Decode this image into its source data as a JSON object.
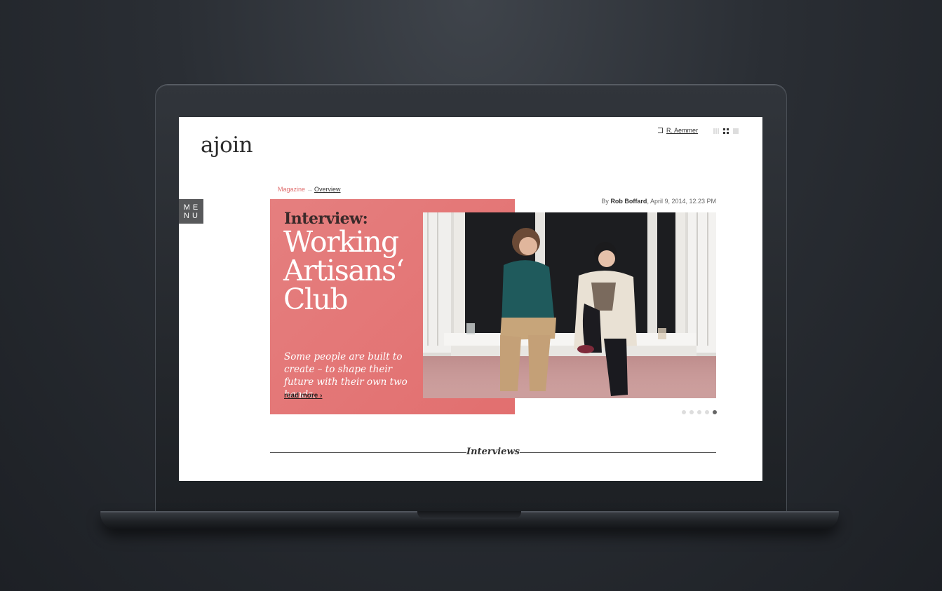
{
  "site": {
    "logo": "ajoin",
    "user_name": "R. Aemmer",
    "menu_label_line1": "ME",
    "menu_label_line2": "NU"
  },
  "breadcrumb": {
    "section": "Magazine",
    "separator": "→",
    "current": "Overview"
  },
  "article": {
    "byline_prefix": "By",
    "author": "Rob Boffard",
    "date": ", April 9, 2014, 12.23 PM",
    "kicker": "Interview:",
    "headline_line1": "Working",
    "headline_line2": "Artisans‘",
    "headline_line3": "Club",
    "teaser": "Some people are built to create – to shape their future with their own two hands.",
    "read_more": "read more ›"
  },
  "slider": {
    "total": 5,
    "active_index": 5
  },
  "section_title": "Interviews",
  "colors": {
    "accent_pink": "#e57575",
    "menu_bg": "#58595b",
    "text_dark": "#2b2b2b"
  },
  "icons": [
    "login-icon",
    "list-view-icon",
    "grid-view-icon",
    "single-view-icon"
  ]
}
